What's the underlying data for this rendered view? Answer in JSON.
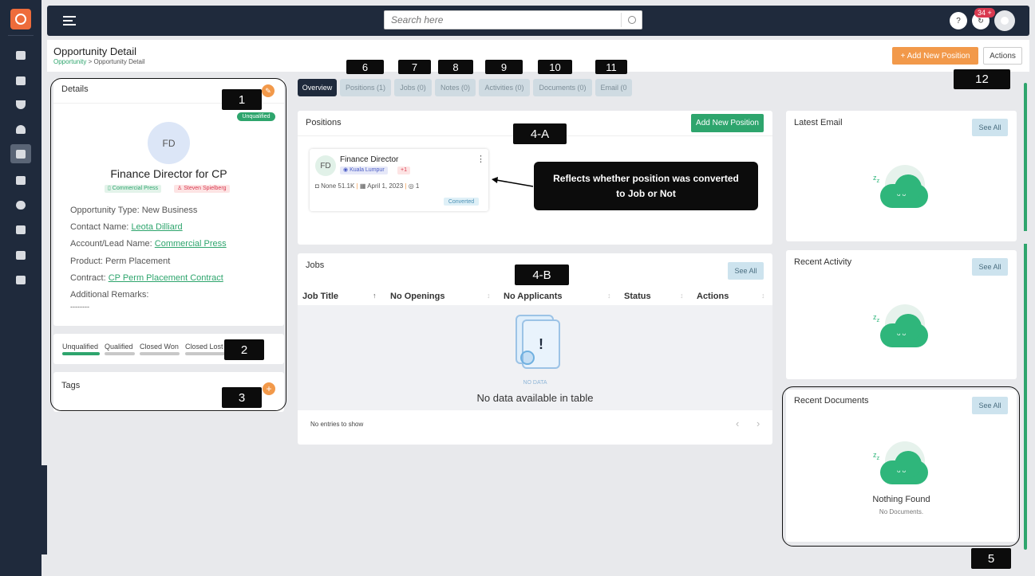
{
  "search": {
    "placeholder": "Search here"
  },
  "topbar": {
    "help": "?",
    "notif_count": "34 +",
    "notif_icon": "sync-icon",
    "avatar_icon": "user-icon"
  },
  "header": {
    "title": "Opportunity Detail",
    "crumb_link": "Opportunity",
    "crumb_sep": " > ",
    "crumb_current": "Opportunity Detail",
    "add_position": "+ Add New Position",
    "actions": "Actions"
  },
  "details": {
    "title": "Details",
    "status": "Unqualified",
    "avatar": "FD",
    "name": "Finance Director for CP",
    "company_tag": "Commercial Press",
    "owner_tag": "Steven Spielberg",
    "opportunity_type_label": "Opportunity Type:",
    "opportunity_type": "New Business",
    "contact_label": "Contact Name:",
    "contact": "Leota Dilliard",
    "account_label": "Account/Lead Name:",
    "account": "Commercial Press",
    "product_label": "Product:",
    "product": "Perm Placement",
    "contract_label": "Contract:",
    "contract": "CP Perm Placement Contract",
    "remarks_label": "Additional Remarks:",
    "remarks": "--------"
  },
  "stages": [
    "Unqualified",
    "Qualified",
    "Closed Won",
    "Closed Lost"
  ],
  "stage_progress_fraction": 0.25,
  "tags": {
    "title": "Tags"
  },
  "tabs": [
    "Overview",
    "Positions (1)",
    "Jobs (0)",
    "Notes (0)",
    "Activities (0)",
    "Documents (0)",
    "Email (0"
  ],
  "positions": {
    "title": "Positions",
    "add_button": "Add New Position",
    "card": {
      "avatar": "FD",
      "title": "Finance Director",
      "location": "Kuala Lumpur",
      "extra": "+1",
      "salary": "None 51.1K",
      "date": "April 1, 2023",
      "openings": "1",
      "status": "Converted"
    }
  },
  "annotation": {
    "callout": "Reflects whether position was converted to Job or Not"
  },
  "jobs": {
    "title": "Jobs",
    "see_all": "See All",
    "columns": [
      "Job Title",
      "No Openings",
      "No Applicants",
      "Status",
      "Actions"
    ],
    "no_data_small": "NO DATA",
    "no_data": "No data available in table",
    "entries": "No entries to show"
  },
  "right": {
    "latest_email": "Latest Email",
    "recent_activity": "Recent Activity",
    "recent_documents": "Recent Documents",
    "see_all": "See All",
    "nothing_found": "Nothing Found",
    "no_documents": "No Documents."
  },
  "markers": {
    "m1": "1",
    "m2": "2",
    "m3": "3",
    "m4a": "4-A",
    "m4b": "4-B",
    "m5": "5",
    "m6": "6",
    "m7": "7",
    "m8": "8",
    "m9": "9",
    "m10": "10",
    "m11": "11",
    "m12": "12"
  },
  "colors": {
    "sidebar": "#1f2a3c",
    "accent_green": "#2ea56d",
    "accent_orange": "#f2994a",
    "tab_inactive": "#cfdbe2"
  }
}
